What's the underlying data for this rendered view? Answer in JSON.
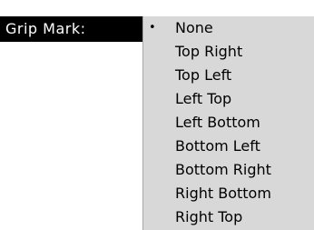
{
  "control": {
    "label": "Grip Mark:"
  },
  "menu": {
    "selected_marker": "•",
    "items": [
      {
        "label": "None",
        "selected": true
      },
      {
        "label": "Top Right",
        "selected": false
      },
      {
        "label": "Top Left",
        "selected": false
      },
      {
        "label": "Left Top",
        "selected": false
      },
      {
        "label": "Left Bottom",
        "selected": false
      },
      {
        "label": "Bottom Left",
        "selected": false
      },
      {
        "label": "Bottom Right",
        "selected": false
      },
      {
        "label": "Right Bottom",
        "selected": false
      },
      {
        "label": "Right Top",
        "selected": false
      }
    ]
  },
  "colors": {
    "label_background": "#000000",
    "label_text": "#ffffff",
    "menu_background": "#d8d8d8",
    "menu_text": "#000000"
  }
}
